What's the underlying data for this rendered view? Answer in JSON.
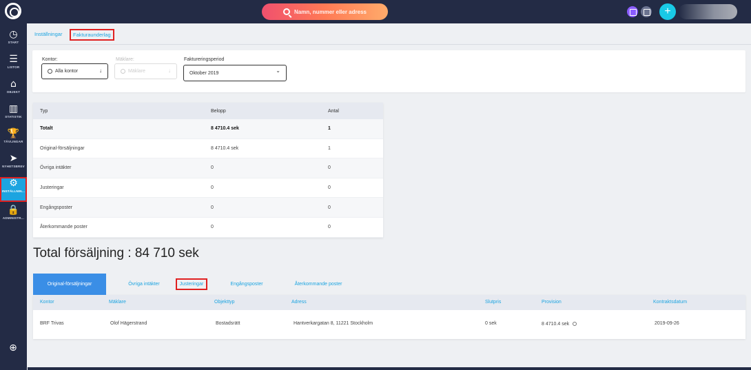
{
  "topbar": {
    "search_placeholder": "Namn, nummer eller adress",
    "add_label": "+"
  },
  "sidebar": {
    "items": [
      {
        "label": "START",
        "glyph": "◷"
      },
      {
        "label": "LISTOR",
        "glyph": "☰"
      },
      {
        "label": "OBJEKT",
        "glyph": "⌂"
      },
      {
        "label": "STATISTIK",
        "glyph": "▥"
      },
      {
        "label": "TÄVLINGAR",
        "glyph": "🏆"
      },
      {
        "label": "NYHETSBREV",
        "glyph": "➤"
      },
      {
        "label": "INSTÄLLNIN...",
        "glyph": "⚙"
      },
      {
        "label": "ADMINISTR...",
        "glyph": "🔒"
      }
    ],
    "bottom_glyph": "⊕"
  },
  "breadcrumb": {
    "settings": "Inställningar",
    "current": "Fakturaunderlag"
  },
  "filters": {
    "kontor_label": "Kontor:",
    "kontor_value": "Alla kontor",
    "maklare_label": "Mäklare:",
    "maklare_value": "Mäklare",
    "period_label": "Faktureringsperiod",
    "period_value": "Oktober 2019",
    "arrow": "↓",
    "chevron": "⌄"
  },
  "summary": {
    "headers": {
      "typ": "Typ",
      "belopp": "Belopp",
      "antal": "Antal"
    },
    "rows": [
      {
        "typ": "Totalt",
        "belopp": "8 4710.4 sek",
        "antal": "1"
      },
      {
        "typ": "Original-försäljningar",
        "belopp": "8 4710.4 sek",
        "antal": "1"
      },
      {
        "typ": "Övriga intäkter",
        "belopp": "0",
        "antal": "0"
      },
      {
        "typ": "Justeringar",
        "belopp": "0",
        "antal": "0"
      },
      {
        "typ": "Engångsposter",
        "belopp": "0",
        "antal": "0"
      },
      {
        "typ": "Återkommande poster",
        "belopp": "0",
        "antal": "0"
      }
    ]
  },
  "total_sales": "Total försäljning : 84 710 sek",
  "tabs": [
    "Original-försäljningar",
    "Övriga intäkter",
    "Justeringar",
    "Engångsposter",
    "Återkommande poster"
  ],
  "details": {
    "headers": [
      "Kontor",
      "Mäklare",
      "Objekttyp",
      "Adress",
      "Slutpris",
      "Provision",
      "Kontraktsdatum"
    ],
    "row": [
      "BRF Trivas",
      "Olof Hägerstrand",
      "Bostadsrätt",
      "Hantverkargatan 8, 11221 Stockholm",
      "0 sek",
      "8 4710.4 sek",
      "2019-09-26"
    ]
  }
}
